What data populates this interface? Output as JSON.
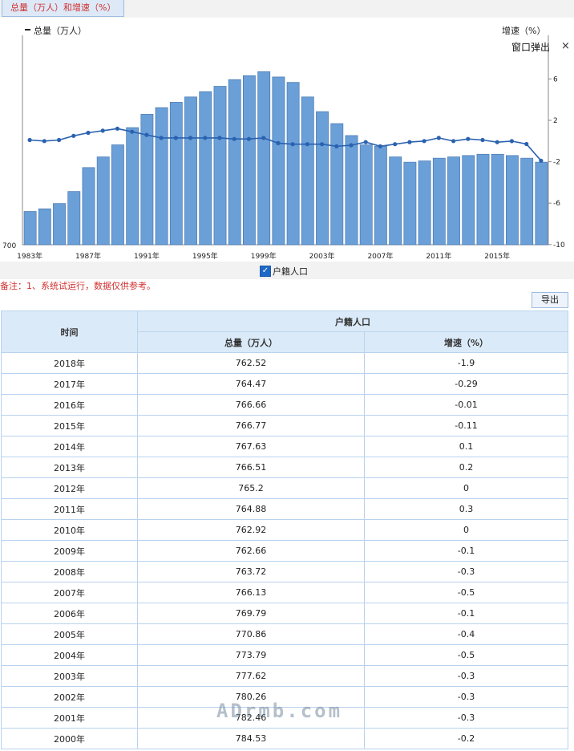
{
  "tab": {
    "label": "总量（万人）和增速（%）"
  },
  "chart_data": {
    "type": "bar",
    "left_axis_label": "总量（万人）",
    "right_axis_label": "增速（%）",
    "left_tick_label": "700",
    "right_ticks": [
      "6",
      "2",
      "-2",
      "-6",
      "-10"
    ],
    "x": [
      1983,
      1984,
      1985,
      1986,
      1987,
      1988,
      1989,
      1990,
      1991,
      1992,
      1993,
      1994,
      1995,
      1996,
      1997,
      1998,
      1999,
      2000,
      2001,
      2002,
      2003,
      2004,
      2005,
      2006,
      2007,
      2008,
      2009,
      2010,
      2011,
      2012,
      2013,
      2014,
      2015,
      2016,
      2017,
      2018
    ],
    "x_tick_labels": [
      "1983年",
      "1987年",
      "1991年",
      "1995年",
      "1999年",
      "2003年",
      "2007年",
      "2011年",
      "2015年"
    ],
    "totals": [
      725,
      727,
      731,
      740,
      758,
      766,
      775,
      788,
      798,
      803,
      807,
      811,
      815,
      819,
      824,
      827,
      830,
      826,
      822,
      811,
      800,
      791,
      782,
      775,
      774,
      766,
      762,
      763,
      765,
      766,
      767,
      768,
      768,
      767,
      765,
      762
    ],
    "growth": [
      0.1,
      0.0,
      0.1,
      0.5,
      0.8,
      1.0,
      1.2,
      0.9,
      0.6,
      0.3,
      0.3,
      0.3,
      0.3,
      0.3,
      0.2,
      0.2,
      0.3,
      -0.2,
      -0.3,
      -0.3,
      -0.3,
      -0.5,
      -0.4,
      -0.1,
      -0.5,
      -0.3,
      -0.1,
      0,
      0.3,
      0,
      0.2,
      0.1,
      -0.11,
      -0.01,
      -0.29,
      -1.9
    ]
  },
  "popup": {
    "label": "窗口弹出",
    "close": "×"
  },
  "legend": {
    "label": "户籍人口",
    "check": "✓"
  },
  "note": "备注：1、系统试运行，数据仅供参考。",
  "export": "导出",
  "table": {
    "h_time": "时间",
    "h_group": "户籍人口",
    "h_total": "总量（万人）",
    "h_growth": "增速（%）",
    "rows": [
      [
        "2018年",
        "762.52",
        "-1.9"
      ],
      [
        "2017年",
        "764.47",
        "-0.29"
      ],
      [
        "2016年",
        "766.66",
        "-0.01"
      ],
      [
        "2015年",
        "766.77",
        "-0.11"
      ],
      [
        "2014年",
        "767.63",
        "0.1"
      ],
      [
        "2013年",
        "766.51",
        "0.2"
      ],
      [
        "2012年",
        "765.2",
        "0"
      ],
      [
        "2011年",
        "764.88",
        "0.3"
      ],
      [
        "2010年",
        "762.92",
        "0"
      ],
      [
        "2009年",
        "762.66",
        "-0.1"
      ],
      [
        "2008年",
        "763.72",
        "-0.3"
      ],
      [
        "2007年",
        "766.13",
        "-0.5"
      ],
      [
        "2006年",
        "769.79",
        "-0.1"
      ],
      [
        "2005年",
        "770.86",
        "-0.4"
      ],
      [
        "2004年",
        "773.79",
        "-0.5"
      ],
      [
        "2003年",
        "777.62",
        "-0.3"
      ],
      [
        "2002年",
        "780.26",
        "-0.3"
      ],
      [
        "2001年",
        "782.46",
        "-0.3"
      ],
      [
        "2000年",
        "784.53",
        "-0.2"
      ]
    ]
  },
  "watermark": "ADrmb.com",
  "colors": {
    "bar": "#6a9fd8",
    "bar_edge": "#3f6fa8",
    "line": "#2a62b0",
    "note": "#d03030"
  }
}
